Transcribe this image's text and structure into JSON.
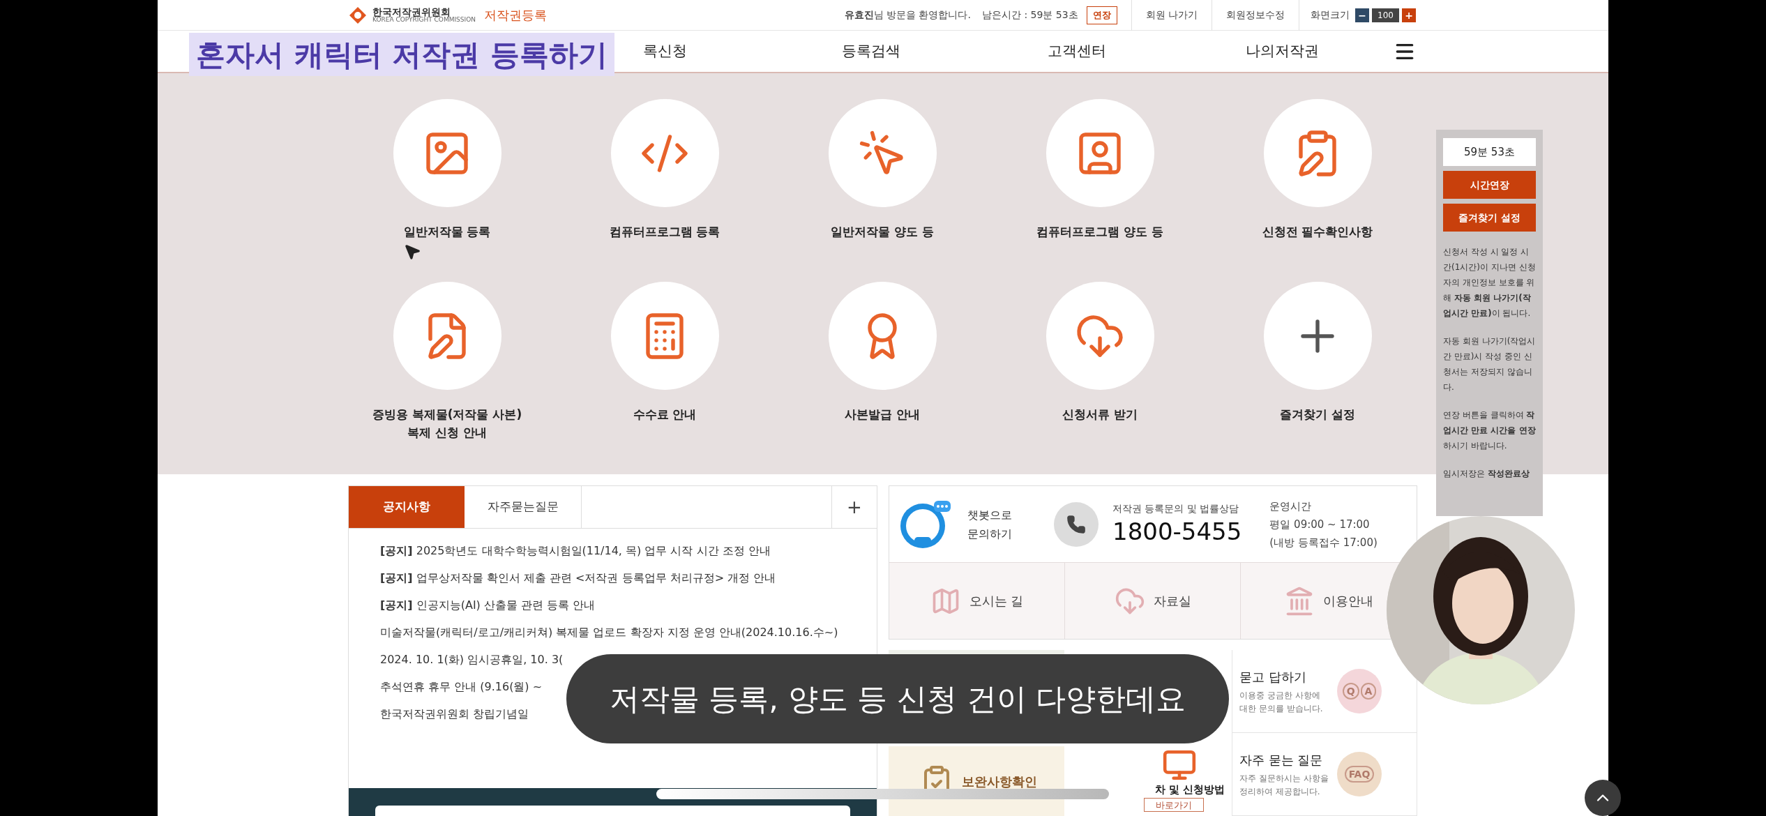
{
  "top_bar": {
    "logo_name": "한국저작권위원회",
    "logo_subtitle": "KOREA COPYRIGHT COMMISSION",
    "service_name": "저작권등록",
    "welcome": "**유효진**님 방문을 환영합니다.",
    "remaining_time": "남은시간 : 59분 53초",
    "extend_button": "연장",
    "links": [
      "회원 나가기",
      "회원정보수정"
    ],
    "zoom": {
      "label": "화면크기",
      "decrease": "−",
      "value": "100",
      "increase": "+"
    }
  },
  "nav": {
    "items": [
      "록신청",
      "등록검색",
      "고객센터",
      "나의저작권"
    ]
  },
  "video_title": "혼자서 캐릭터 저작권 등록하기",
  "services": [
    {
      "label": "일반저작물 등록"
    },
    {
      "label": "컴퓨터프로그램 등록"
    },
    {
      "label": "일반저작물 양도 등"
    },
    {
      "label": "컴퓨터프로그램 양도 등"
    },
    {
      "label": "신청전 필수확인사항"
    },
    {
      "label": "증빙용 복제물(저작물 사본)\n복제 신청 안내"
    },
    {
      "label": "수수료 안내"
    },
    {
      "label": "사본발급 안내"
    },
    {
      "label": "신청서류 받기"
    },
    {
      "label": "즐겨찾기 설정"
    }
  ],
  "sidebar": {
    "timer": "59분 53초",
    "buttons": [
      "시간연장",
      "즐겨찾기 설정"
    ],
    "notes": [
      "신청서 작성 시 일정 시간(1시간)이 지나면 신청자의 개인정보 보호를 위해 **자동 회원 나가기(작업시간 만료)**이 됩니다.",
      "자동 회원 나가기(작업시간 만료)시 작성 중인 신청서는 저장되지 않습니다.",
      "연장 버튼을 클릭하여 **작업시간 만료 시간을 연장**하시기 바랍니다.",
      "임시저장은 **작성완료상**"
    ]
  },
  "notices": {
    "tabs": [
      {
        "label": "공지사항",
        "selected": true
      },
      {
        "label": "자주묻는질문",
        "selected": false
      }
    ],
    "more": "+",
    "items": [
      "**[공지]** 2025학년도 대학수학능력시험일(11/14, 목) 업무 시작 시간 조정 안내",
      "**[공지]** 업무상저작물 확인서 제출 관련 <저작권 등록업무 처리규정> 개정 안내",
      "**[공지]** 인공지능(AI) 산출물 관련 등록 안내",
      "미술저작물(캐릭터/로고/캐리커쳐) 복제물 업로드 확장자 지정 운영 안내(2024.10.16.수~)",
      "2024. 10. 1(화) 임시공휴일, 10. 3(",
      "추석연휴 휴무 안내 (9.16(월) ~",
      "한국저작권위원회 창립기념일"
    ]
  },
  "contact": {
    "chatbot": "챗봇으로\n문의하기",
    "phone_label": "저작권 등록문의 및 법률상담",
    "phone": "1800-5455",
    "hours_label": "운영시간",
    "hours": [
      "평일 09:00 ~ 17:00",
      "(내방 등록접수 17:00)"
    ]
  },
  "quick_links": [
    "오시는 길",
    "자료실",
    "이용안내"
  ],
  "guides": {
    "check_title": "보완사항확인",
    "method_title": "차 및 신청방법",
    "goto_button": "바로가기"
  },
  "help_cards": [
    {
      "title": "묻고 답하기",
      "description": "이용중 궁금한 사항에\n대한 문의를 받습니다.",
      "letters": [
        "Q",
        "A"
      ],
      "color": "#f4d6da"
    },
    {
      "title": "자주 묻는 질문",
      "description": "자주 질문하시는 사항을\n정리하여 제공합니다.",
      "letters": [
        "FAQ"
      ],
      "color": "#efdcc8"
    }
  ],
  "subtitle": "저작물 등록, 양도 등 신청 건이 다양한데요"
}
